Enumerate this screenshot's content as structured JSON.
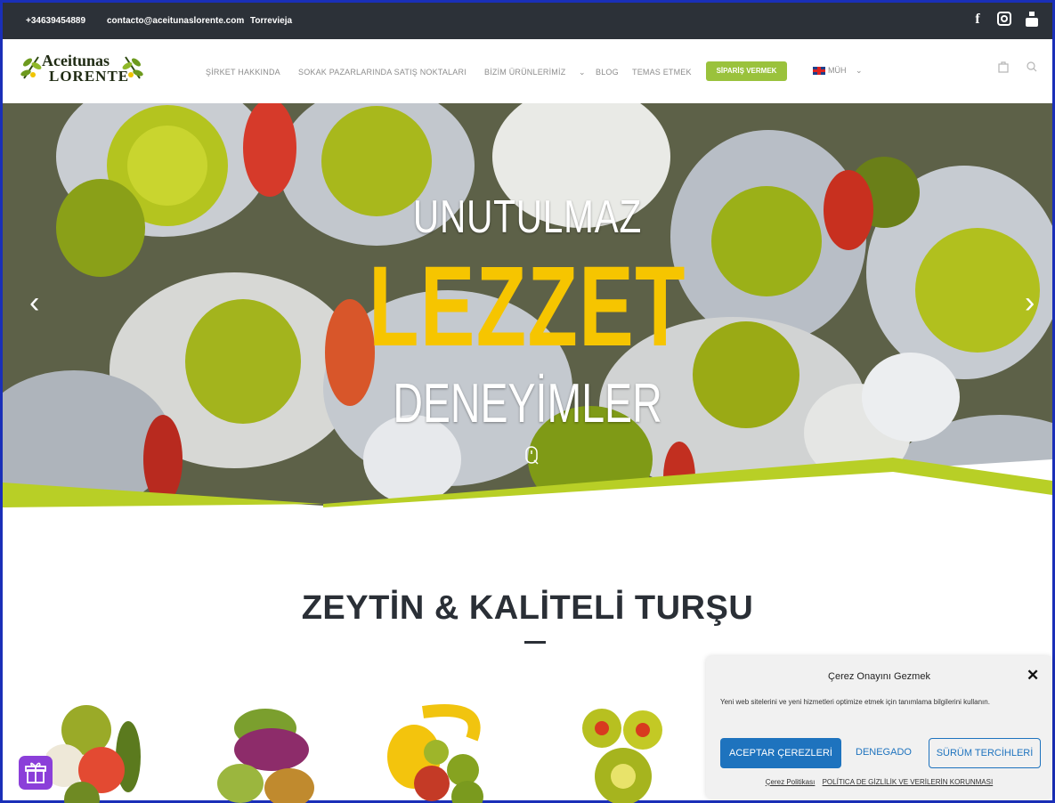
{
  "topbar": {
    "phone": "+34639454889",
    "email": "contacto@aceitunaslorente.com",
    "city": "Torrevieja",
    "social_icons": [
      "facebook-icon",
      "instagram-icon",
      "youtube-icon"
    ]
  },
  "header": {
    "logo_line1": "Aceitunas",
    "logo_line2": "LORENTE",
    "nav": {
      "about": "ŞİRKET HAKKINDA",
      "markets": "SOKAK PAZARLARINDA SATIŞ NOKTALARI",
      "products": "BİZİM ÜRÜNLERİMİZ",
      "blog": "BLOG",
      "contact": "TEMAS ETMEK"
    },
    "order_button": "SİPARİŞ VERMEK",
    "language": "MÜH"
  },
  "hero": {
    "line1": "UNUTULMAZ",
    "line2": "LEZZET",
    "line3": "DENEYİMLER"
  },
  "section": {
    "title": "ZEYTİN & KALİTELİ TURŞU"
  },
  "cookie": {
    "title": "Çerez Onayını Gezmek",
    "text": "Yeni web sitelerini ve yeni hizmetleri optimize etmek için tanımlama bilgilerini kullanın.",
    "accept": "ACEPTAR ÇEREZLERİ",
    "deny": "DENEGADO",
    "prefs": "SÜRÜM TERCİHLERİ",
    "link1": "Çerez Politikası",
    "link2": "POLÍTICA DE GİZLİLİK VE VERİLERİN KORUNMASI"
  },
  "colors": {
    "topbar": "#2c3138",
    "accent_green": "#9ac23c",
    "hero_yellow": "#f6c500",
    "button_blue": "#1e73be",
    "gift_purple": "#8b3fd9"
  }
}
